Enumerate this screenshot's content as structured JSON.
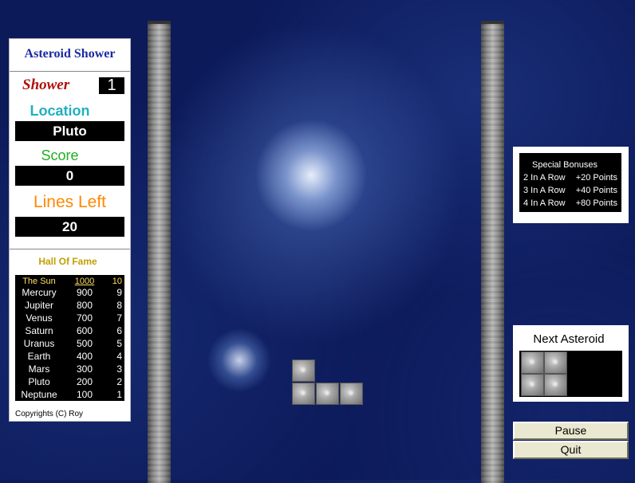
{
  "game": {
    "title": "Asteroid Shower",
    "shower_label": "Shower",
    "shower_value": "1",
    "location_label": "Location",
    "location_value": "Pluto",
    "score_label": "Score",
    "score_value": "0",
    "lines_left_label": "Lines Left",
    "lines_left_value": "20"
  },
  "hall_of_fame": {
    "title": "Hall Of Fame",
    "entries": [
      {
        "name": "The Sun",
        "score": "1000",
        "rank": "10"
      },
      {
        "name": "Mercury",
        "score": "900",
        "rank": "9"
      },
      {
        "name": "Jupiter",
        "score": "800",
        "rank": "8"
      },
      {
        "name": "Venus",
        "score": "700",
        "rank": "7"
      },
      {
        "name": "Saturn",
        "score": "600",
        "rank": "6"
      },
      {
        "name": "Uranus",
        "score": "500",
        "rank": "5"
      },
      {
        "name": "Earth",
        "score": "400",
        "rank": "4"
      },
      {
        "name": "Mars",
        "score": "300",
        "rank": "3"
      },
      {
        "name": "Pluto",
        "score": "200",
        "rank": "2"
      },
      {
        "name": "Neptune",
        "score": "100",
        "rank": "1"
      }
    ]
  },
  "copyright": "Copyrights (C) Roy",
  "bonuses": {
    "title": "Special Bonuses",
    "rows": [
      {
        "label": "2 In A Row",
        "points": "+20 Points"
      },
      {
        "label": "3 In A Row",
        "points": "+40 Points"
      },
      {
        "label": "4 In A Row",
        "points": "+80 Points"
      }
    ]
  },
  "next_asteroid": {
    "title": "Next Asteroid"
  },
  "buttons": {
    "pause": "Pause",
    "quit": "Quit"
  },
  "colors": {
    "background": "#0c1a5a",
    "title": "#1a2aa0",
    "shower": "#b01010",
    "location": "#20b0c0",
    "score": "#20b020",
    "lines_left": "#ff8800",
    "hall_of_fame": "#c0a000"
  }
}
